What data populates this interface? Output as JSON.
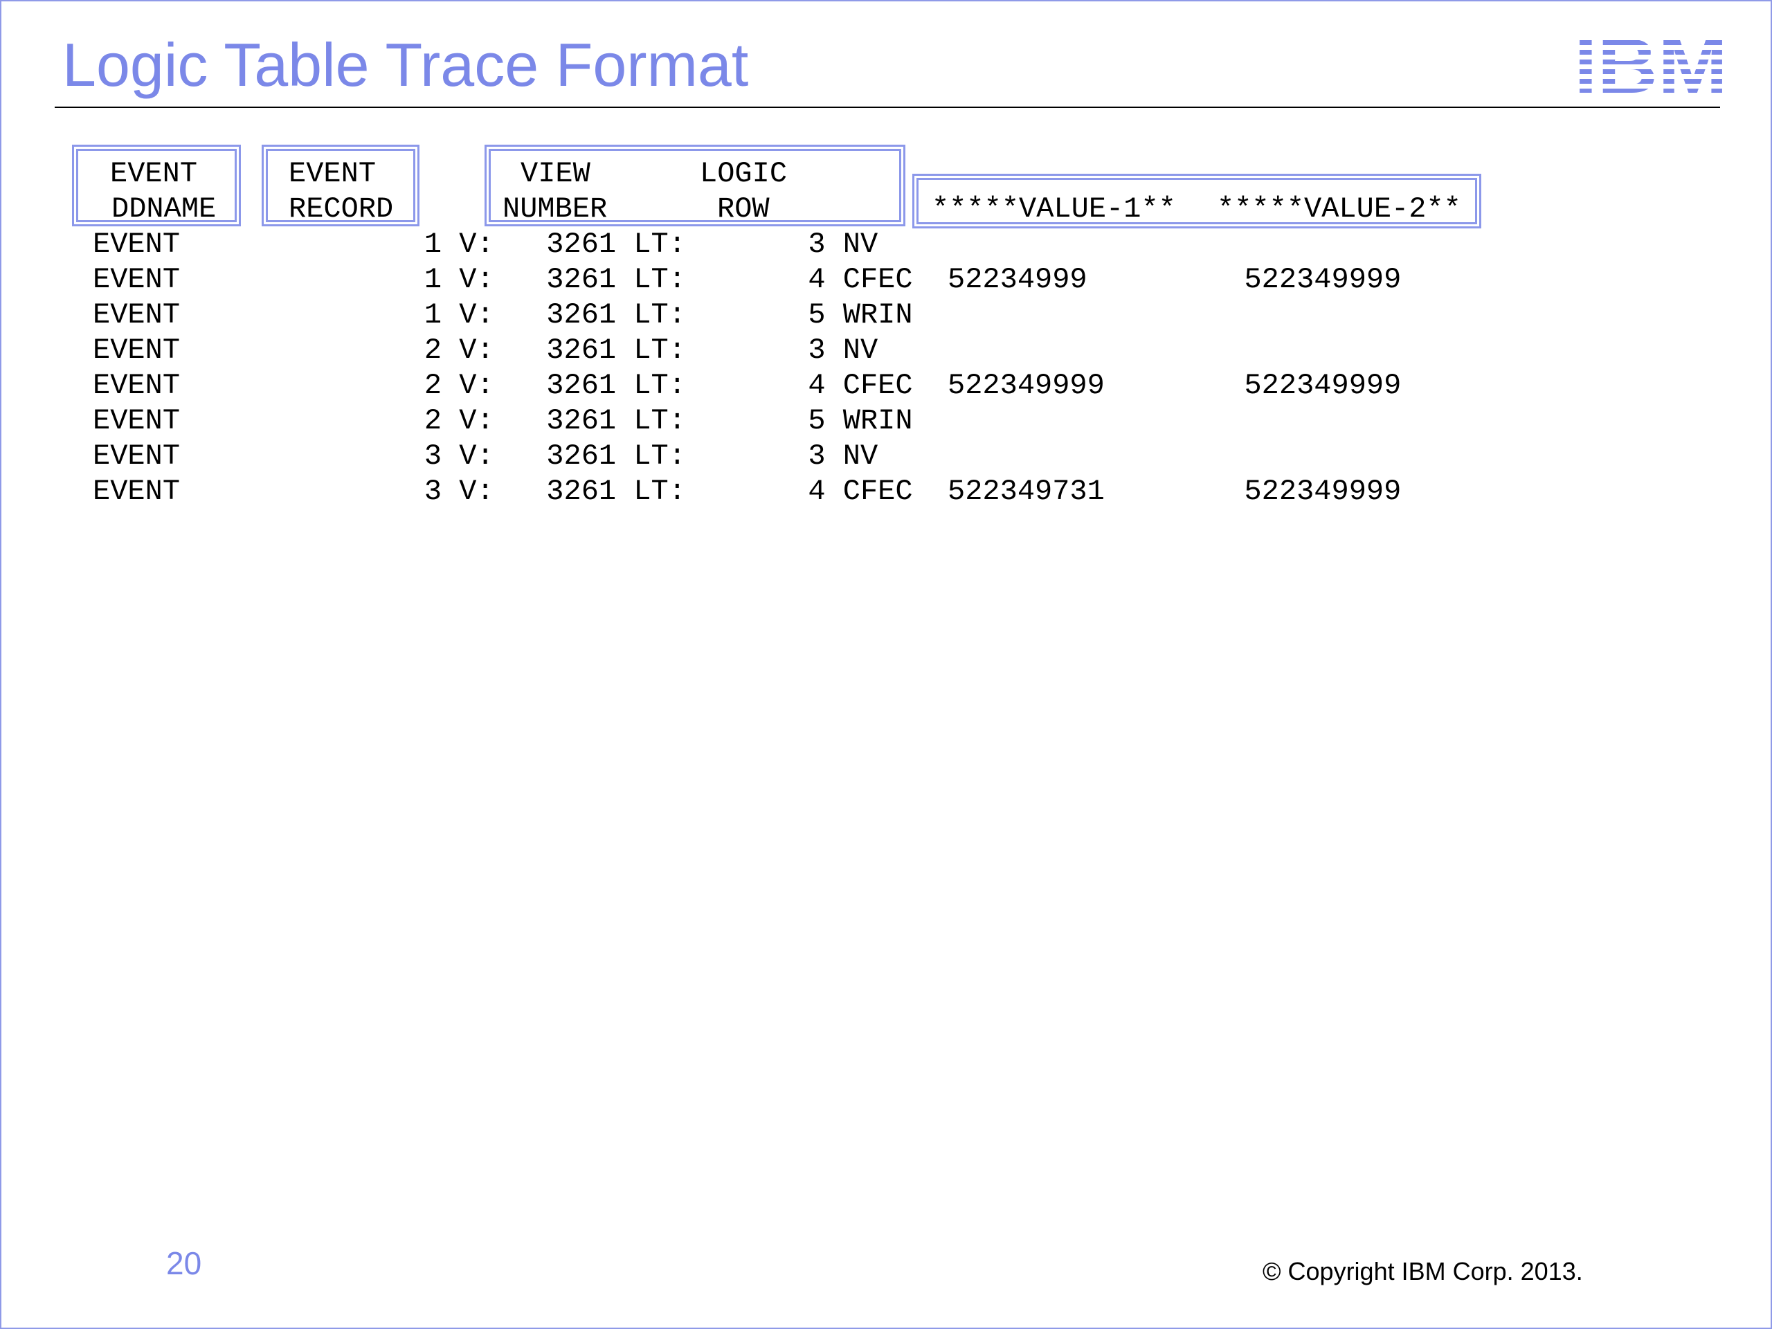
{
  "slide": {
    "title": "Logic Table Trace Format",
    "logo_text": "IBM",
    "page_number": "20",
    "copyright": "© Copyright IBM Corp. 2013."
  },
  "colors": {
    "title": "#7b88e8",
    "box_border": "#8c98ea",
    "slide_border": "#8f9ae8",
    "text": "#000000"
  },
  "header": {
    "event_ddname": [
      "EVENT",
      "DDNAME"
    ],
    "event_record": [
      "EVENT",
      "RECORD"
    ],
    "view_number": [
      "VIEW",
      "NUMBER"
    ],
    "logic_row": [
      "LOGIC",
      "ROW"
    ],
    "value1": "*****VALUE-1**",
    "value2": "*****VALUE-2**"
  },
  "rows": [
    "EVENT              1 V:   3261 LT:       3 NV",
    "EVENT              1 V:   3261 LT:       4 CFEC  52234999         522349999",
    "EVENT              1 V:   3261 LT:       5 WRIN",
    "EVENT              2 V:   3261 LT:       3 NV",
    "EVENT              2 V:   3261 LT:       4 CFEC  522349999        522349999",
    "EVENT              2 V:   3261 LT:       5 WRIN",
    "EVENT              3 V:   3261 LT:       3 NV",
    "EVENT              3 V:   3261 LT:       4 CFEC  522349731        522349999"
  ]
}
